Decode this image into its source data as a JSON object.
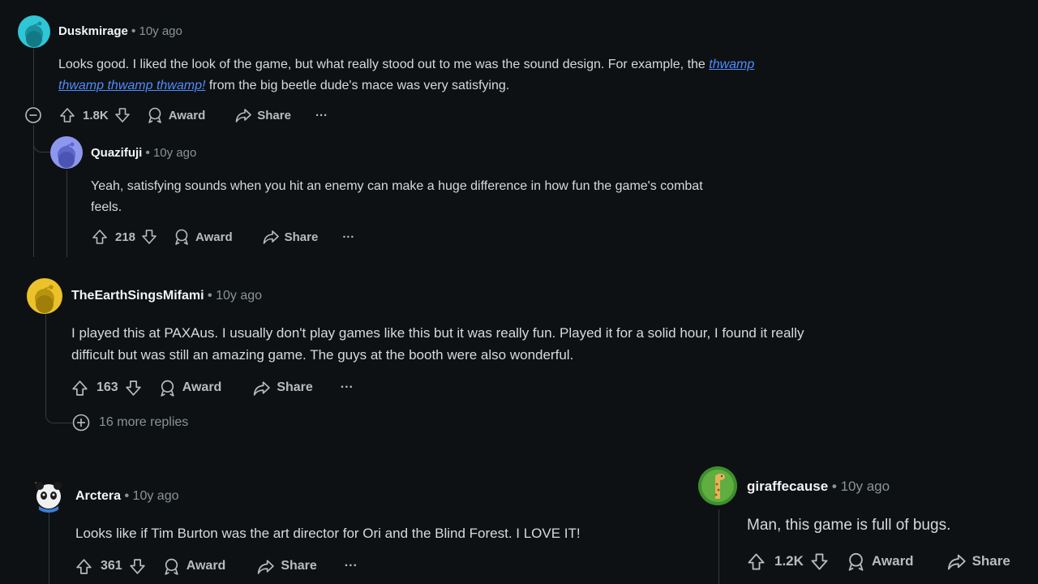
{
  "comments": [
    {
      "author": "Duskmirage",
      "separator": "•",
      "time": "10y ago",
      "text_before": "Looks good. I liked the look of the game, but what really stood out to me was the sound design. For example, the ",
      "link_text": "thwamp thwamp thwamp thwamp!",
      "text_after": " from the big beetle dude's mace was very satisfying.",
      "votes": "1.8K",
      "award_label": "Award",
      "share_label": "Share",
      "more_label": "···",
      "avatar_color": "#2fc6d6"
    },
    {
      "author": "Quazifuji",
      "separator": "•",
      "time": "10y ago",
      "text": "Yeah, satisfying sounds when you hit an enemy can make a huge difference in how fun the game's combat feels.",
      "votes": "218",
      "award_label": "Award",
      "share_label": "Share",
      "more_label": "···",
      "avatar_color": "#8e97ee"
    },
    {
      "author": "TheEarthSingsMifami",
      "separator": "•",
      "time": "10y ago",
      "text": "I played this at PAXAus. I usually don't play games like this but it was really fun. Played it for a solid hour, I found it really difficult but was still an amazing game. The guys at the booth were also wonderful.",
      "votes": "163",
      "award_label": "Award",
      "share_label": "Share",
      "more_label": "···",
      "more_replies": "16 more replies",
      "avatar_color": "#ecc22a"
    },
    {
      "author": "Arctera",
      "separator": "•",
      "time": "10y ago",
      "text": "Looks like if Tim Burton was the art director for Ori and the Blind Forest. I LOVE IT!",
      "votes": "361",
      "award_label": "Award",
      "share_label": "Share",
      "more_label": "···"
    },
    {
      "author": "giraffecause",
      "separator": "•",
      "time": "10y ago",
      "text": "Man, this game is full of bugs.",
      "votes": "1.2K",
      "award_label": "Award",
      "share_label": "Share",
      "avatar_color": "#3d8f2e"
    }
  ],
  "colors": {
    "background": "#0e1113",
    "text": "#d7dadc",
    "muted": "#8a9396",
    "link": "#4f8cff"
  }
}
